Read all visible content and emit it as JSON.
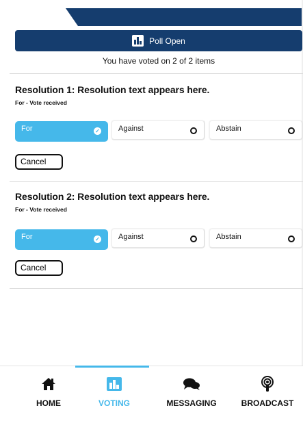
{
  "poll": {
    "banner_label": "Poll Open",
    "voted_status": "You have voted on 2 of 2 items"
  },
  "resolutions": [
    {
      "title": "Resolution 1: Resolution text appears here.",
      "status": "For - Vote received",
      "options": [
        "For",
        "Against",
        "Abstain"
      ],
      "selected": "For",
      "cancel_label": "Cancel"
    },
    {
      "title": "Resolution 2: Resolution text appears here.",
      "status": "For - Vote received",
      "options": [
        "For",
        "Against",
        "Abstain"
      ],
      "selected": "For",
      "cancel_label": "Cancel"
    }
  ],
  "nav": {
    "items": [
      {
        "label": "HOME",
        "icon": "home-icon"
      },
      {
        "label": "VOTING",
        "icon": "bar-chart-icon",
        "active": true
      },
      {
        "label": "MESSAGING",
        "icon": "chat-bubbles-icon"
      },
      {
        "label": "BROADCAST",
        "icon": "podcast-icon"
      }
    ]
  },
  "colors": {
    "banner": "#153d6e",
    "accent": "#45b8ea"
  }
}
